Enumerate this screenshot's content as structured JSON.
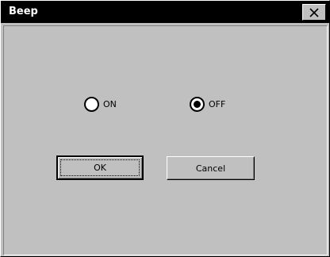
{
  "window": {
    "title": "Beep"
  },
  "options": [
    {
      "label": "ON",
      "selected": false
    },
    {
      "label": "OFF",
      "selected": true
    }
  ],
  "buttons": {
    "ok_label": "OK",
    "cancel_label": "Cancel"
  },
  "icons": {
    "close": "close-icon"
  }
}
